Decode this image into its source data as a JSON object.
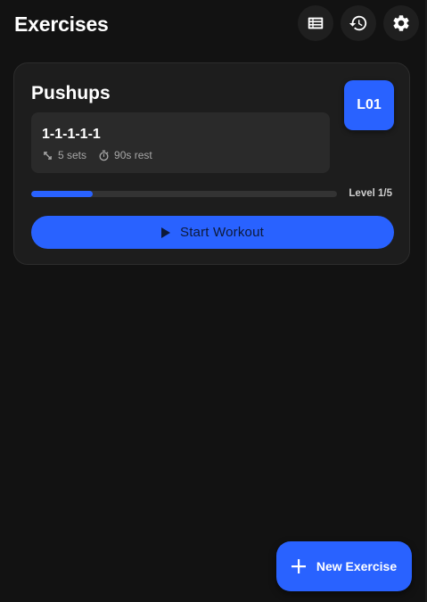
{
  "header": {
    "title": "Exercises",
    "buttons": [
      {
        "name": "list-view-button",
        "icon": "list-icon"
      },
      {
        "name": "history-button",
        "icon": "history-icon"
      },
      {
        "name": "settings-button",
        "icon": "gear-icon"
      }
    ]
  },
  "exercise_card": {
    "name": "Pushups",
    "level_badge": "L01",
    "scheme": "1-1-1-1-1",
    "sets_text": "5 sets",
    "sets_icon": "expand-arrows-icon",
    "rest_text": "90s rest",
    "rest_icon": "stopwatch-icon",
    "progress_fraction": 0.2,
    "level_text": "Level 1/5",
    "start_button_label": "Start Workout",
    "start_icon": "play-icon"
  },
  "fab": {
    "label": "New Exercise",
    "icon": "plus-icon"
  },
  "colors": {
    "background": "#121212",
    "card": "#1d1d1d",
    "accent": "#2962ff"
  }
}
